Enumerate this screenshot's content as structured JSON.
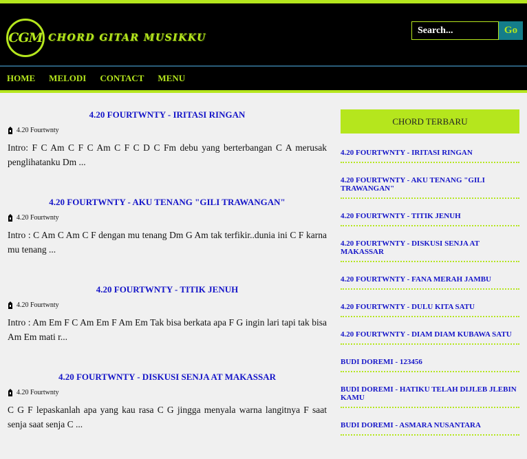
{
  "site": {
    "logo_mark": "CGM",
    "logo_text": "CHORD GITAR MUSIKKU"
  },
  "search": {
    "placeholder": "Search...",
    "button_label": "Go"
  },
  "nav": [
    "HOME",
    "MELODI",
    "CONTACT",
    "MENU"
  ],
  "posts": [
    {
      "title": "4.20 FOURTWNTY - IRITASI RINGAN",
      "author": "4.20 Fourtwnty",
      "excerpt": "Intro: F C Am C F C Am C F C D C Fm debu yang berterbangan C A merusak penglihatanku Dm ..."
    },
    {
      "title": "4.20 FOURTWNTY - AKU TENANG \"GILI TRAWANGAN\"",
      "author": "4.20 Fourtwnty",
      "excerpt": "Intro : C Am C Am C F dengan mu tenang Dm G Am tak terfikir..dunia ini C F karna mu tenang ..."
    },
    {
      "title": "4.20 FOURTWNTY - TITIK JENUH",
      "author": "4.20 Fourtwnty",
      "excerpt": "Intro : Am Em F C Am Em F Am Em Tak bisa berkata apa F G ingin lari tapi tak bisa Am Em mati r..."
    },
    {
      "title": "4.20 FOURTWNTY - DISKUSI SENJA AT MAKASSAR",
      "author": "4.20 Fourtwnty",
      "excerpt": "C G F lepaskanlah apa yang kau rasa C G jingga menyala warna langitnya F saat senja saat senja C ..."
    }
  ],
  "sidebar": {
    "heading": "CHORD TERBARU",
    "items": [
      "4.20 FOURTWNTY - IRITASI RINGAN",
      "4.20 FOURTWNTY - AKU TENANG \"GILI TRAWANGAN\"",
      "4.20 FOURTWNTY - TITIK JENUH",
      "4.20 FOURTWNTY - DISKUSI SENJA AT MAKASSAR",
      "4.20 FOURTWNTY - FANA MERAH JAMBU",
      "4.20 FOURTWNTY - DULU KITA SATU",
      "4.20 FOURTWNTY - DIAM DIAM KUBAWA SATU",
      "BUDI DOREMI - 123456",
      "BUDI DOREMI - HATIKU TELAH DIJLEB JLEBIN KAMU",
      "BUDI DOREMI - ASMARA NUSANTARA"
    ]
  },
  "colors": {
    "accent": "#b5e61d",
    "link": "#1515c8",
    "header_bg": "#000000",
    "go_button": "#147d8a"
  }
}
